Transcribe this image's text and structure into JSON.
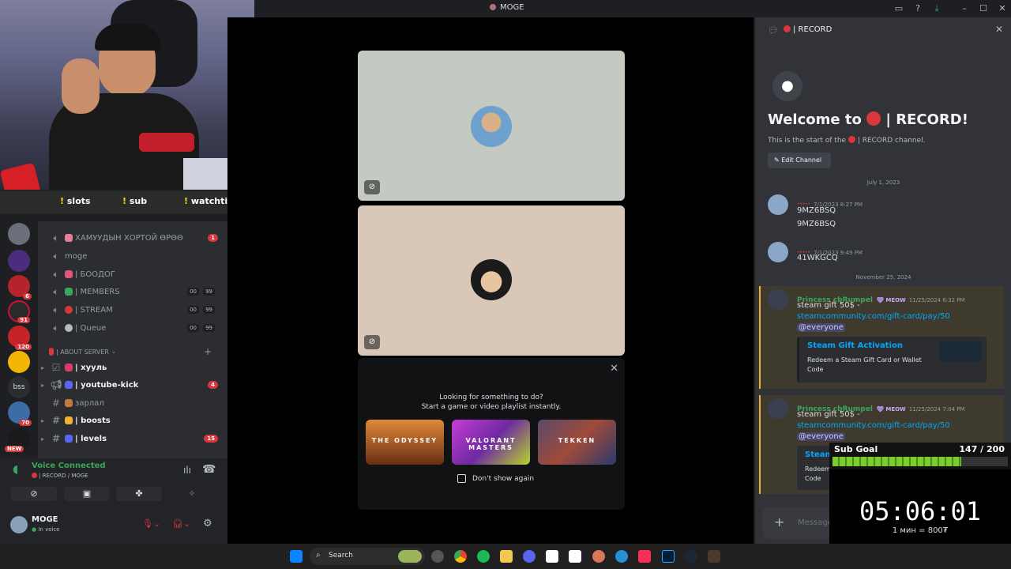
{
  "window": {
    "title": "MOGE"
  },
  "overlay": {
    "commands": [
      "slots",
      "sub",
      "watchtime"
    ],
    "sub_goal": {
      "label": "Sub Goal",
      "count": "147 / 200",
      "progress": 0.735
    },
    "timer": "05:06:01",
    "rate": "1 мин = 800₮"
  },
  "servers": [
    {
      "badge": ""
    },
    {
      "badge": ""
    },
    {
      "badge": "6"
    },
    {
      "badge": "91"
    },
    {
      "badge": "120"
    },
    {
      "badge": ""
    },
    {
      "label": "bss"
    },
    {
      "badge": "70"
    },
    {
      "badge": "NEW"
    }
  ],
  "channels": [
    {
      "name": "ХАМУУДЫН ХОРТОЙ ӨРӨӨ",
      "type": "voice",
      "badge": "1",
      "emoji_color": "#e87d9b"
    },
    {
      "name": "moge",
      "type": "voice"
    },
    {
      "name": "| БООДОГ",
      "type": "voice",
      "emoji_color": "#e0567a"
    },
    {
      "name": "| MEMBERS",
      "type": "voice",
      "count_a": "00",
      "count_b": "99",
      "emoji_color": "#3ba55c"
    },
    {
      "name": "| STREAM",
      "type": "voice",
      "count_a": "00",
      "count_b": "99",
      "emoji_color": "#da373c"
    },
    {
      "name": "| Queue",
      "type": "voice",
      "count_a": "00",
      "count_b": "99",
      "emoji_color": "#b5bac1"
    }
  ],
  "category": {
    "name": "| ABOUT SERVER"
  },
  "text_channels": [
    {
      "name": "| хууль",
      "bold": true,
      "emoji_color": "#d83c6a"
    },
    {
      "name": "| youtube-kick",
      "bold": true,
      "badge": "4",
      "emoji_color": "#5865f2"
    },
    {
      "name": "зарлал",
      "bold": false,
      "emoji_color": "#c07a3a"
    },
    {
      "name": "| boosts",
      "bold": true,
      "emoji_color": "#f0b232"
    },
    {
      "name": "| levels",
      "bold": true,
      "badge": "15",
      "emoji_color": "#5865f2"
    }
  ],
  "voice_panel": {
    "status": "Voice Connected",
    "location": "| RECORD / MOGE",
    "user": "MOGE",
    "user_status": "In voice"
  },
  "activity": {
    "heading": "Looking for something to do?",
    "sub": "Start a game or video playlist instantly.",
    "games": [
      "THE ODYSSEY",
      "VALORANT MASTERS",
      "TEKKEN"
    ],
    "dont_show": "Don't show again"
  },
  "chat": {
    "channel": "| RECORD",
    "welcome": "Welcome to",
    "welcome_channel": "| RECORD!",
    "start_text": "This is the start of the",
    "start_channel": "| RECORD channel.",
    "edit_channel": "Edit Channel",
    "date1": "July 1, 2023",
    "date2": "November 25, 2024",
    "messages": [
      {
        "author": "·····",
        "time": "7/1/2023 8:27 PM",
        "lines": [
          "9MZ6BSQ",
          "9MZ6BSQ"
        ]
      },
      {
        "author": "·····",
        "time": "7/1/2023 9:49 PM",
        "lines": [
          "41WKGCQ"
        ]
      },
      {
        "author": "Princess cbRumpel",
        "tag": "MEOW",
        "time": "11/25/2024 6:32 PM",
        "text": "steam gift 50$ -",
        "link": "steamcommunity.com/gift-card/pay/50",
        "mention": "@everyone",
        "embed_title": "Steam Gift Activation",
        "embed_desc": "Redeem a Steam Gift Card or Wallet Code"
      },
      {
        "author": "Princess cbRumpel",
        "tag": "MEOW",
        "time": "11/25/2024 7:04 PM",
        "text": "steam gift 50$ -",
        "link": "steamcommunity.com/gift-card/pay/50",
        "mention": "@everyone",
        "embed_title": "Steam",
        "embed_desc": "Redeem Steam Gift Card or Wallet Code"
      }
    ],
    "input_placeholder": "Message"
  },
  "taskbar": {
    "search": "Search"
  }
}
